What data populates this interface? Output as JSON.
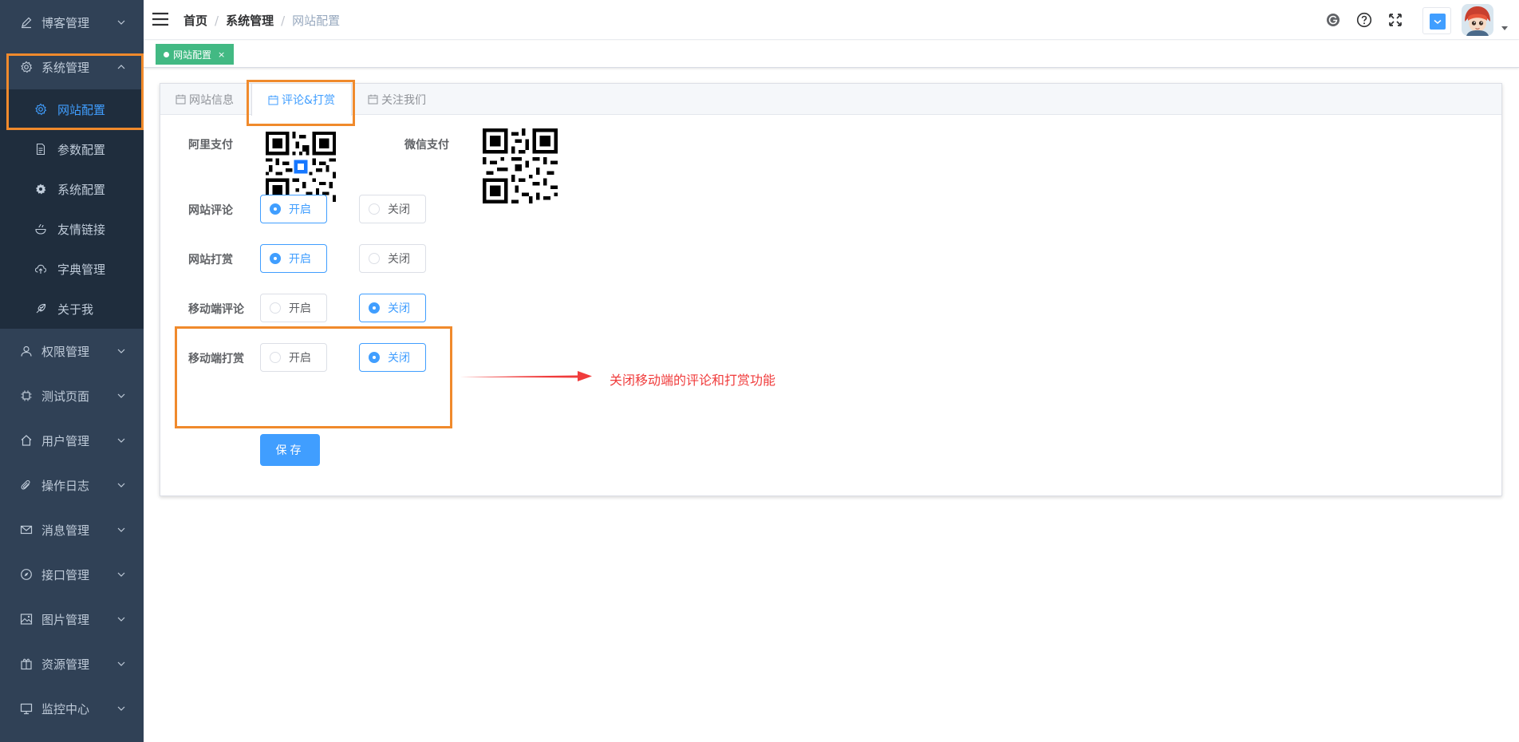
{
  "sidebar": {
    "items": [
      {
        "label": "博客管理",
        "icon": "pencil-icon"
      },
      {
        "label": "系统管理",
        "icon": "gear-outline-icon"
      },
      {
        "label": "权限管理",
        "icon": "user-icon"
      },
      {
        "label": "测试页面",
        "icon": "chip-icon"
      },
      {
        "label": "用户管理",
        "icon": "home-icon"
      },
      {
        "label": "操作日志",
        "icon": "paperclip-icon"
      },
      {
        "label": "消息管理",
        "icon": "mail-icon"
      },
      {
        "label": "接口管理",
        "icon": "compass-icon"
      },
      {
        "label": "图片管理",
        "icon": "picture-icon"
      },
      {
        "label": "资源管理",
        "icon": "box-icon"
      },
      {
        "label": "监控中心",
        "icon": "monitor-icon"
      }
    ],
    "submenu": [
      {
        "label": "网站配置",
        "icon": "gear-outline-icon"
      },
      {
        "label": "参数配置",
        "icon": "document-icon"
      },
      {
        "label": "系统配置",
        "icon": "gear-solid-icon"
      },
      {
        "label": "友情链接",
        "icon": "bowl-icon"
      },
      {
        "label": "字典管理",
        "icon": "cloud-upload-icon"
      },
      {
        "label": "关于我",
        "icon": "feather-icon"
      }
    ]
  },
  "breadcrumb": [
    "首页",
    "系统管理",
    "网站配置"
  ],
  "tags": {
    "active_tag": "网站配置",
    "close": "×"
  },
  "tabs": [
    "网站信息",
    "评论&打赏",
    "关注我们"
  ],
  "form": {
    "alipay_label": "阿里支付",
    "wechat_label": "微信支付",
    "rows": [
      {
        "label": "网站评论",
        "options": [
          "开启",
          "关闭"
        ],
        "selected": "开启"
      },
      {
        "label": "网站打赏",
        "options": [
          "开启",
          "关闭"
        ],
        "selected": "开启"
      },
      {
        "label": "移动端评论",
        "options": [
          "开启",
          "关闭"
        ],
        "selected": "关闭"
      },
      {
        "label": "移动端打赏",
        "options": [
          "开启",
          "关闭"
        ],
        "selected": "关闭"
      }
    ],
    "save": "保存"
  },
  "annotation": {
    "text": "关闭移动端的评论和打赏功能"
  },
  "colors": {
    "sidebar_bg": "#304156",
    "submenu_bg": "#1f2d3d",
    "accent": "#409eff",
    "tag_green": "#42b983",
    "highlight": "#f08a2c",
    "annotation_red": "#f03c3c"
  }
}
